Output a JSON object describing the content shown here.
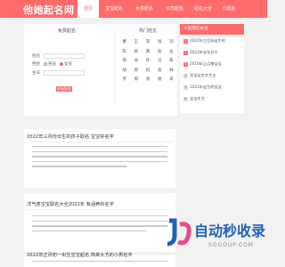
{
  "header": {
    "logo": "他她起名网",
    "nav": [
      "首页",
      "宝宝起名",
      "女孩起名",
      "公司起名",
      "起名大全",
      "日起名"
    ],
    "active_index": 0,
    "brand_color": "#ff6b6b"
  },
  "free_name": {
    "title": "免费起名",
    "surname_label": "姓氏",
    "gender_label": "性别",
    "male": "男孩",
    "female": "女孩",
    "birthday_label": "生日",
    "submit": "开始起名"
  },
  "hot_surnames": {
    "title": "热门姓氏",
    "items": [
      "曹",
      "王",
      "李",
      "张",
      "刘",
      "陈",
      "杨",
      "黄",
      "赵",
      "吴",
      "周",
      "徐",
      "孙",
      "马",
      "朱",
      "胡",
      "郭",
      "何",
      "高",
      "林",
      "罗",
      "郑",
      "梁",
      "谢",
      "宋"
    ]
  },
  "sidebar": {
    "title": "大家都在关注",
    "items": [
      {
        "num": "1",
        "text": "2022年三月份出生的"
      },
      {
        "num": "2",
        "text": "2022年宝宝名字"
      },
      {
        "num": "3",
        "text": "2019年正月猪宝宝"
      },
      {
        "num": "4",
        "text": "男宝宝名字大全"
      },
      {
        "num": "5",
        "text": "2021年出生的宝宝"
      },
      {
        "num": "6",
        "text": "宝宝名字"
      }
    ]
  },
  "articles": [
    {
      "title": "2022年三月份出生的孩子取名 宝宝好名字"
    },
    {
      "title": "洋气虎宝宝取名大全2022年 有涵养的名字"
    },
    {
      "title": "2022年正月初一出生宝宝起名 简单大方的小男名字"
    }
  ],
  "watermark": {
    "main": "自动秒收录",
    "sub": "SOGOUP.COM"
  }
}
